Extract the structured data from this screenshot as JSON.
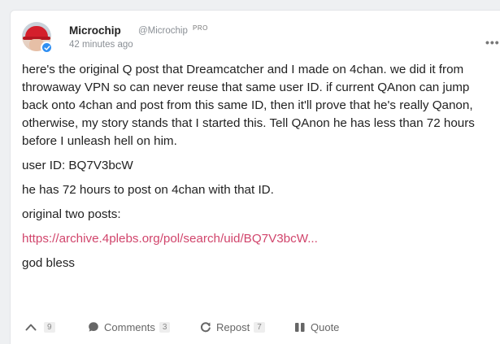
{
  "post": {
    "author": {
      "name": "Microchip",
      "handle": "@Microchip",
      "badge": "PRO",
      "verified": true
    },
    "timestamp": "42 minutes ago",
    "more_menu": "•••",
    "paragraphs": {
      "p1": "here's the original Q post that Dreamcatcher and I made on 4chan. we did it from throwaway VPN so can never reuse that same user ID. if current QAnon can jump back onto 4chan and post from this same ID, then it'll prove that he's really Qanon, otherwise, my story stands that I started this. Tell QAnon he has less than 72 hours before I unleash hell on him.",
      "p2": "user ID: BQ7V3bcW",
      "p3": "he has 72 hours to post on 4chan with that ID.",
      "p4": "original two posts:",
      "link": "https://archive.4plebs.org/pol/search/uid/BQ7V3bcW...",
      "p5": "god bless"
    }
  },
  "actions": {
    "upvote": {
      "icon": "chevron-up-icon",
      "count": "9"
    },
    "comments": {
      "icon": "comment-bubble-icon",
      "label": "Comments",
      "count": "3"
    },
    "repost": {
      "icon": "repost-icon",
      "label": "Repost",
      "count": "7"
    },
    "quote": {
      "icon": "quote-icon",
      "label": "Quote"
    }
  },
  "colors": {
    "link": "#d1456c",
    "verified": "#2f8ff2",
    "muted": "#8a8f95"
  }
}
